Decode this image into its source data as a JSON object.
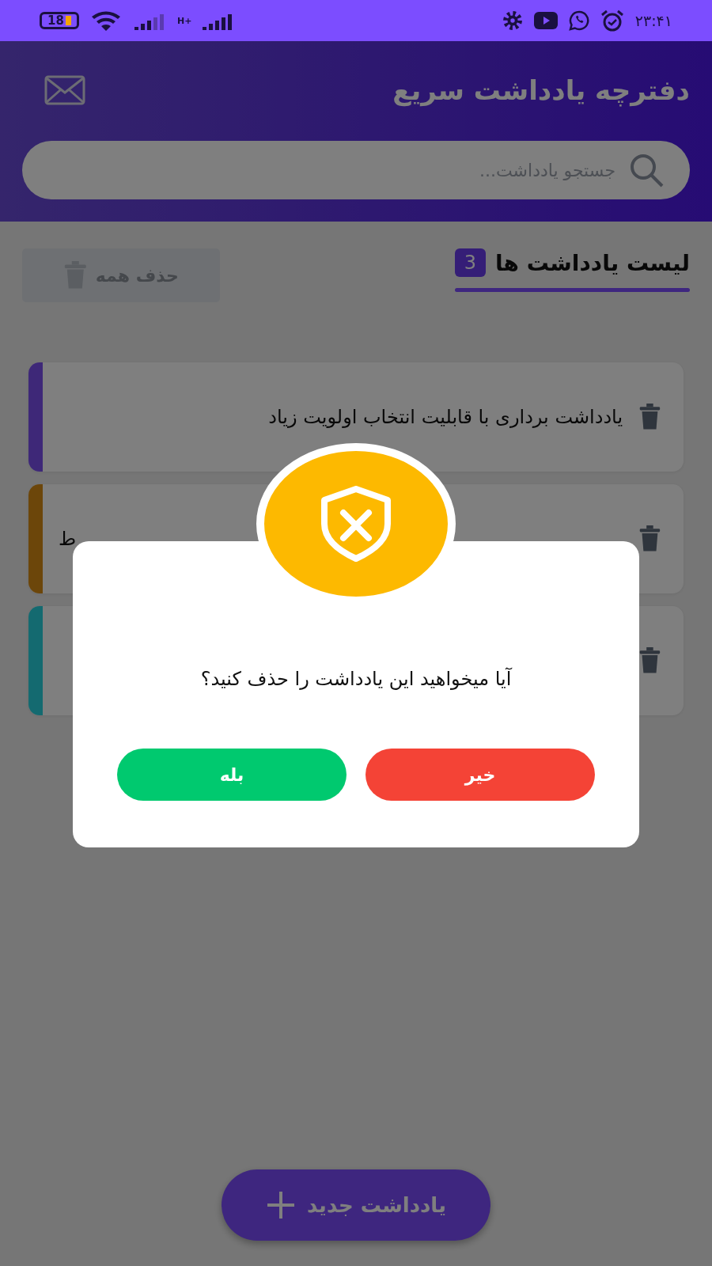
{
  "status_bar": {
    "battery": "18",
    "network": "H+",
    "time": "۲۳:۴۱"
  },
  "header": {
    "title": "دفترچه یادداشت سریع"
  },
  "search": {
    "placeholder": "جستجو یادداشت..."
  },
  "list": {
    "title": "لیست یادداشت ها",
    "count": "3",
    "delete_all": "حذف همه"
  },
  "notes": [
    {
      "text": "یادداشت برداری با قابلیت انتخاب اولویت زیاد",
      "color": "#3e2878"
    },
    {
      "text": "ط",
      "color": "#6c460a"
    },
    {
      "color": "#146a70"
    }
  ],
  "fab": {
    "label": "یادداشت جدید"
  },
  "dialog": {
    "message": "آیا میخواهید این یادداشت را حذف کنید؟",
    "buttons": [
      {
        "label": "خیر",
        "kind": "cancel"
      },
      {
        "label": "بله",
        "kind": "confirm"
      }
    ]
  }
}
